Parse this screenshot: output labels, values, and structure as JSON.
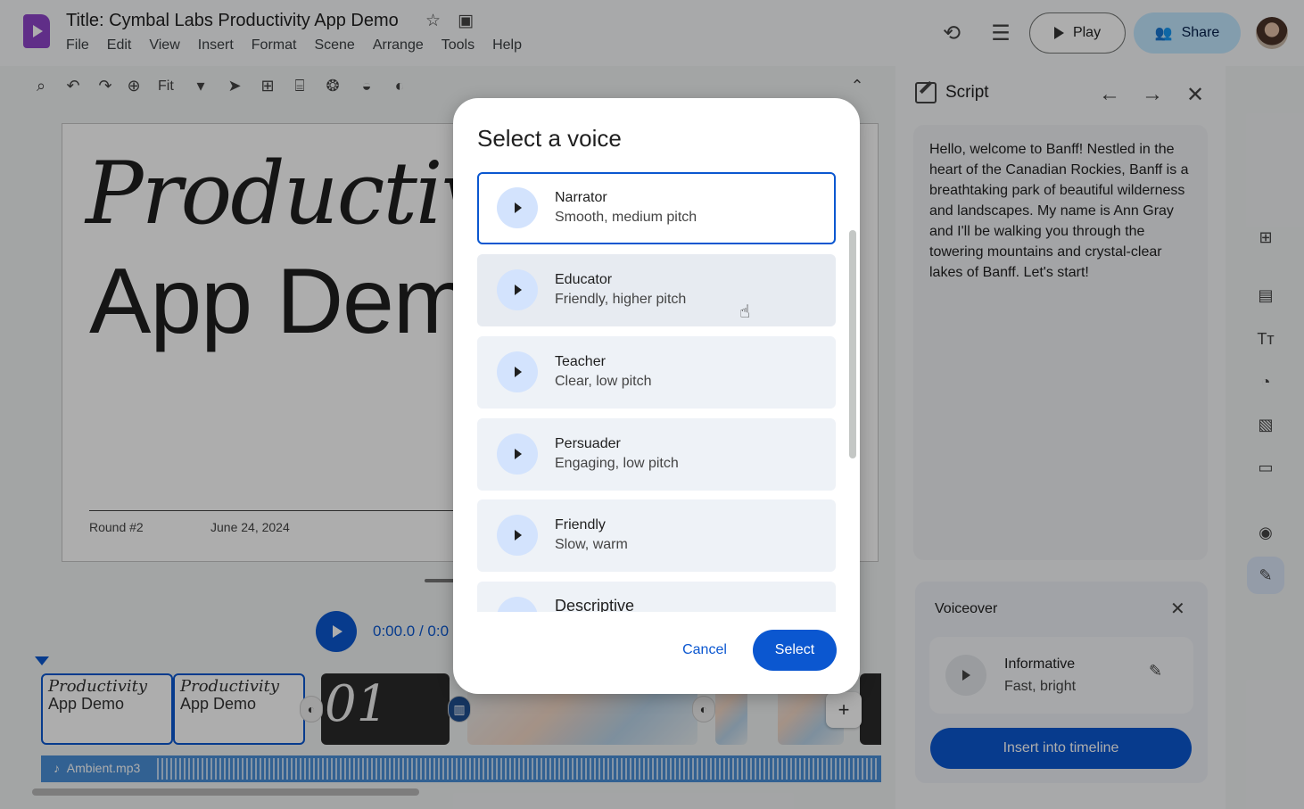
{
  "header": {
    "doc_title": "Title: Cymbal Labs Productivity App Demo",
    "menu": [
      "File",
      "Edit",
      "View",
      "Insert",
      "Format",
      "Scene",
      "Arrange",
      "Tools",
      "Help"
    ],
    "play_label": "Play",
    "share_label": "Share"
  },
  "toolbar": {
    "zoom_label": "Fit"
  },
  "slide": {
    "title_line1": "Productivity",
    "title_line2": "App Demo",
    "footer_left": "Round #2",
    "footer_right": "June 24, 2024"
  },
  "playback": {
    "time": "0:00.0 / 0:0"
  },
  "timeline": {
    "clip1_line1": "Productivity",
    "clip1_line2": "App Demo",
    "clip2_line1": "Productivity",
    "clip2_line2": "App Demo",
    "clip3_number": "01",
    "audio_file": "Ambient.mp3"
  },
  "script_panel": {
    "title": "Script",
    "text": "Hello, welcome to Banff! Nestled in the heart of the Canadian Rockies, Banff is a breathtaking park of beautiful wilderness and landscapes. My name is Ann Gray and I'll be walking you through the towering mountains and crystal-clear lakes of Banff. Let's start!"
  },
  "voiceover": {
    "title": "Voiceover",
    "voice_name": "Informative",
    "voice_desc": "Fast, bright",
    "insert_label": "Insert into timeline"
  },
  "dialog": {
    "title": "Select a voice",
    "voices": [
      {
        "name": "Narrator",
        "desc": "Smooth, medium pitch"
      },
      {
        "name": "Educator",
        "desc": "Friendly, higher pitch"
      },
      {
        "name": "Teacher",
        "desc": "Clear, low pitch"
      },
      {
        "name": "Persuader",
        "desc": "Engaging, low pitch"
      },
      {
        "name": "Friendly",
        "desc": "Slow, warm"
      },
      {
        "name": "Descriptive",
        "desc": ""
      }
    ],
    "cancel_label": "Cancel",
    "select_label": "Select"
  },
  "colors": {
    "accent": "#0b57d0",
    "logo": "#8e44c9",
    "share_bg": "#c2e7ff"
  }
}
